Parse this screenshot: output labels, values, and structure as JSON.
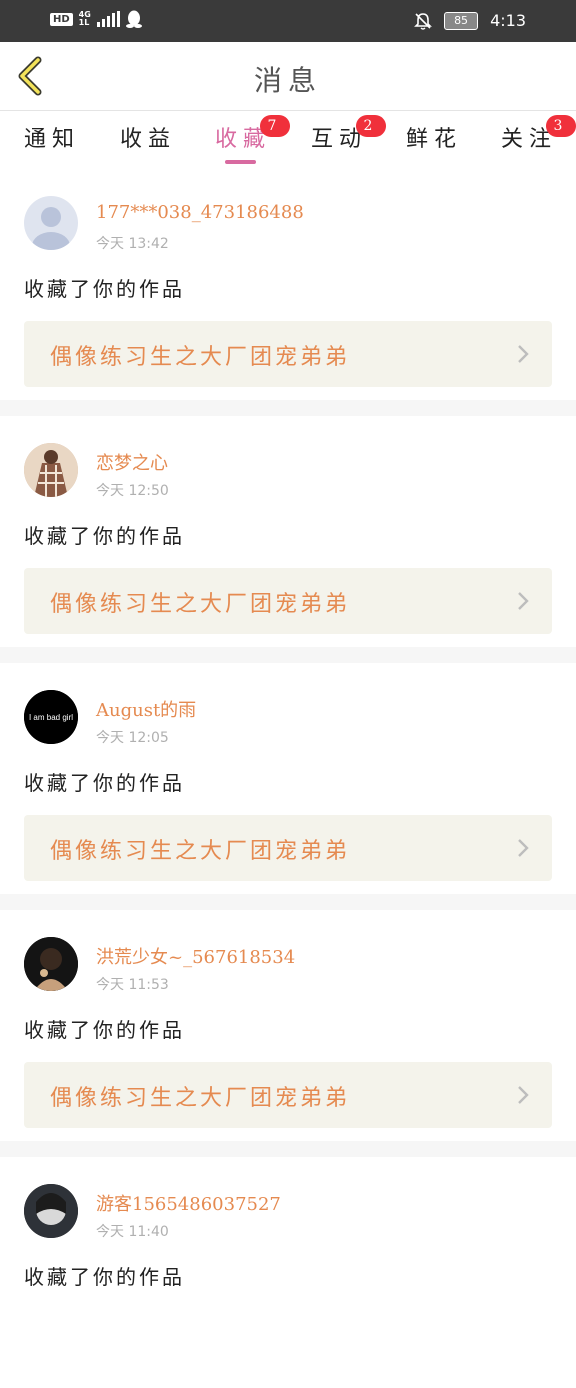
{
  "status_bar": {
    "hd": "HD",
    "network_top": "4G",
    "network_bottom": "1L",
    "battery": "85",
    "time": "4:13"
  },
  "header": {
    "title": "消息"
  },
  "tabs": [
    {
      "label": "通知",
      "badge": ""
    },
    {
      "label": "收益",
      "badge": ""
    },
    {
      "label": "收藏",
      "badge": "7"
    },
    {
      "label": "互动",
      "badge": "2"
    },
    {
      "label": "鲜花",
      "badge": ""
    },
    {
      "label": "关注",
      "badge": "3"
    }
  ],
  "items": [
    {
      "user": "177***038_473186488",
      "time": "今天 13:42",
      "action": "收藏了你的作品",
      "work": "偶像练习生之大厂团宠弟弟"
    },
    {
      "user": "恋梦之心",
      "time": "今天 12:50",
      "action": "收藏了你的作品",
      "work": "偶像练习生之大厂团宠弟弟"
    },
    {
      "user": "August的雨",
      "time": "今天 12:05",
      "action": "收藏了你的作品",
      "work": "偶像练习生之大厂团宠弟弟",
      "avatar_text": "I am bad girl"
    },
    {
      "user": "洪荒少女~_567618534",
      "time": "今天 11:53",
      "action": "收藏了你的作品",
      "work": "偶像练习生之大厂团宠弟弟"
    },
    {
      "user": "游客1565486037527",
      "time": "今天 11:40",
      "action": "收藏了你的作品",
      "work": ""
    }
  ],
  "colors": {
    "accent_pink": "#d86aa0",
    "accent_orange": "#e58a50",
    "badge_red": "#f0303b",
    "status_bar": "#3a3a3a",
    "work_card_bg": "#f4f3eb"
  },
  "icons": [
    "back-chevron-icon",
    "chevron-right-icon",
    "mute-bell-icon",
    "qq-penguin-icon",
    "signal-icon",
    "battery-icon"
  ]
}
